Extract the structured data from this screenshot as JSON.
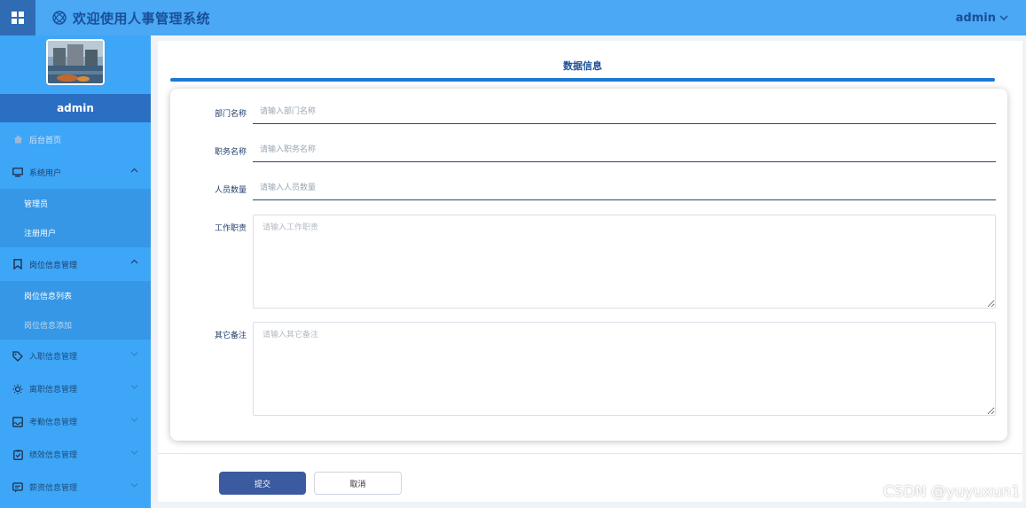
{
  "header": {
    "title": "欢迎使用人事管理系统",
    "user": "admin"
  },
  "sidebar": {
    "username": "admin",
    "items": [
      {
        "label": "后台首页"
      },
      {
        "label": "系统用户"
      },
      {
        "label": "管理员"
      },
      {
        "label": "注册用户"
      },
      {
        "label": "岗位信息管理"
      },
      {
        "label": "岗位信息列表"
      },
      {
        "label": "岗位信息添加"
      },
      {
        "label": "入职信息管理"
      },
      {
        "label": "离职信息管理"
      },
      {
        "label": "考勤信息管理"
      },
      {
        "label": "绩效信息管理"
      },
      {
        "label": "薪资信息管理"
      }
    ]
  },
  "main": {
    "section_title": "数据信息",
    "fields": [
      {
        "label": "部门名称",
        "placeholder": "请输入部门名称",
        "value": ""
      },
      {
        "label": "职务名称",
        "placeholder": "请输入职务名称",
        "value": ""
      },
      {
        "label": "人员数量",
        "placeholder": "请输入人员数量",
        "value": ""
      },
      {
        "label": "工作职责",
        "placeholder": "请输入工作职责",
        "value": ""
      },
      {
        "label": "其它备注",
        "placeholder": "请输入其它备注",
        "value": ""
      }
    ],
    "submit_label": "提交",
    "cancel_label": "取消"
  },
  "watermark": "CSDN @yuyuxun1",
  "colors": {
    "topbar": "#4aa8f5",
    "sidebar": "#3ea6f7",
    "accent": "#1f78d1",
    "primary_button": "#3b5a9f"
  },
  "icons": [
    "grid-icon",
    "app-logo-icon",
    "chevron-down-icon",
    "home-icon",
    "monitor-icon",
    "chevron-up-icon",
    "bookmark-icon",
    "tag-icon",
    "sun-icon",
    "inbox-icon",
    "clipboard-icon",
    "chat-icon"
  ]
}
